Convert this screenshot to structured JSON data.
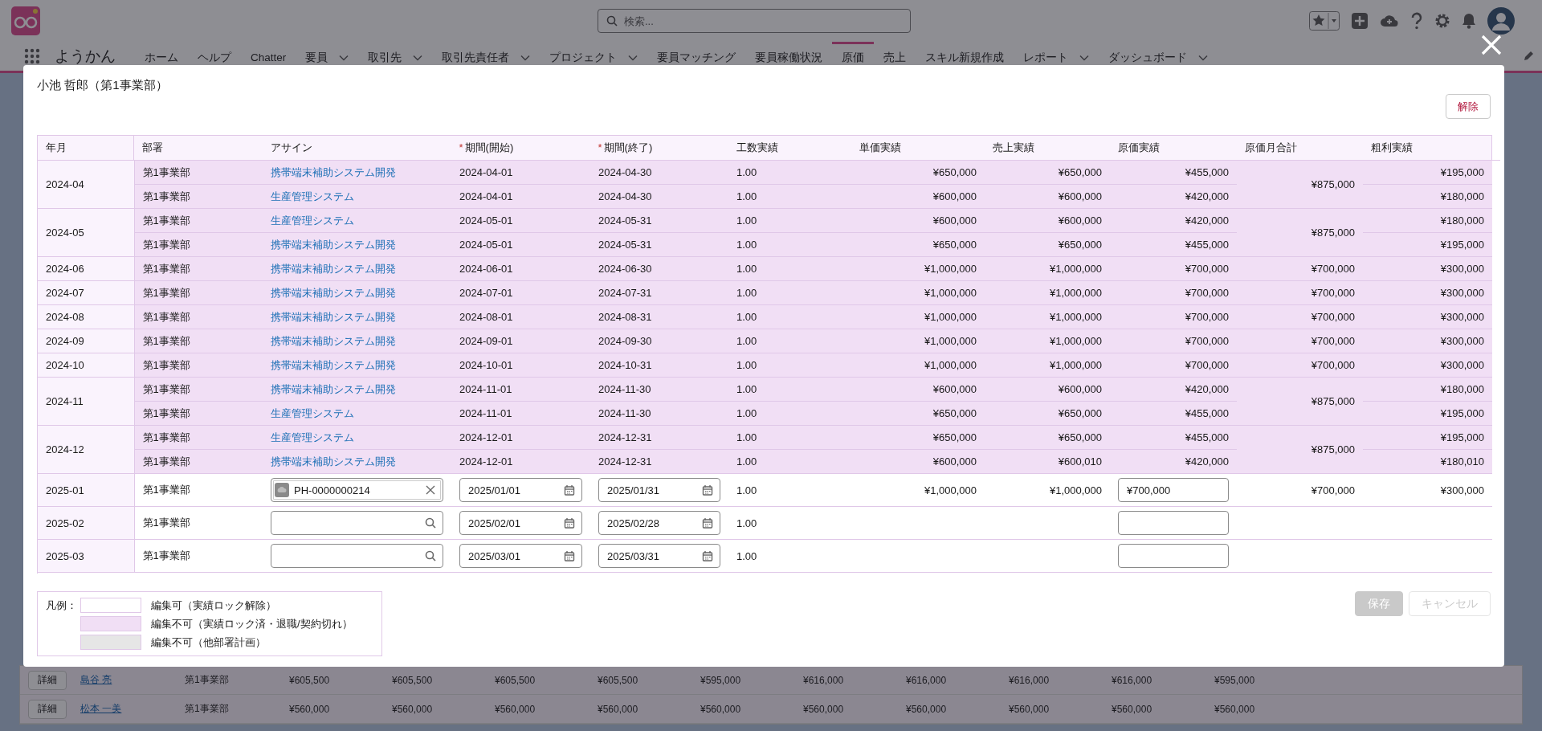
{
  "app": {
    "name": "ようかん",
    "search": {
      "placeholder": "検索..."
    },
    "nav": [
      {
        "label": "ホーム",
        "dropdown": false,
        "selected": false
      },
      {
        "label": "ヘルプ",
        "dropdown": false,
        "selected": false
      },
      {
        "label": "Chatter",
        "dropdown": false,
        "selected": false
      },
      {
        "label": "要員",
        "dropdown": true,
        "selected": false
      },
      {
        "label": "取引先",
        "dropdown": true,
        "selected": false
      },
      {
        "label": "取引先責任者",
        "dropdown": true,
        "selected": false
      },
      {
        "label": "プロジェクト",
        "dropdown": true,
        "selected": false
      },
      {
        "label": "要員マッチング",
        "dropdown": false,
        "selected": false
      },
      {
        "label": "要員稼働状況",
        "dropdown": false,
        "selected": false
      },
      {
        "label": "原価",
        "dropdown": false,
        "selected": true
      },
      {
        "label": "売上",
        "dropdown": false,
        "selected": false
      },
      {
        "label": "スキル新規作成",
        "dropdown": false,
        "selected": false
      },
      {
        "label": "レポート",
        "dropdown": true,
        "selected": false
      },
      {
        "label": "ダッシュボード",
        "dropdown": true,
        "selected": false
      }
    ]
  },
  "background_rows": [
    {
      "button": "詳細",
      "name": "島谷 亮",
      "dept": "第1事業部",
      "amounts": [
        "¥605,500",
        "¥605,500",
        "¥605,500",
        "¥605,500",
        "¥595,000",
        "¥616,000",
        "¥616,000",
        "¥616,000",
        "¥616,000",
        "¥595,000"
      ]
    },
    {
      "button": "詳細",
      "name": "松本 一美",
      "dept": "第1事業部",
      "amounts": [
        "¥560,000",
        "¥560,000",
        "¥560,000",
        "¥560,000",
        "¥560,000",
        "¥560,000",
        "¥560,000",
        "¥560,000",
        "¥560,000",
        "¥560,000"
      ]
    }
  ],
  "modal": {
    "title": "小池 哲郎（第1事業部）",
    "unlock_button": "解除",
    "table": {
      "columns": [
        {
          "label": "年月"
        },
        {
          "label": "部署"
        },
        {
          "label": "アサイン"
        },
        {
          "label": "期間(開始)",
          "marker": "*"
        },
        {
          "label": "期間(終了)",
          "marker": "*"
        },
        {
          "label": "工数実績"
        },
        {
          "label": "単価実績"
        },
        {
          "label": "売上実績"
        },
        {
          "label": "原価実績"
        },
        {
          "label": "原価月合計"
        },
        {
          "label": "粗利実績"
        }
      ],
      "months": [
        {
          "month": "2024-04",
          "locked": true,
          "cost_total": "¥875,000",
          "rows": [
            {
              "dept": "第1事業部",
              "assign": "携帯端末補助システム開発",
              "start": "2024-04-01",
              "end": "2024-04-30",
              "hours": "1.00",
              "unit_price": "¥650,000",
              "sales": "¥650,000",
              "cost": "¥455,000",
              "profit": "¥195,000"
            },
            {
              "dept": "第1事業部",
              "assign": "生産管理システム",
              "start": "2024-04-01",
              "end": "2024-04-30",
              "hours": "1.00",
              "unit_price": "¥600,000",
              "sales": "¥600,000",
              "cost": "¥420,000",
              "profit": "¥180,000"
            }
          ]
        },
        {
          "month": "2024-05",
          "locked": true,
          "cost_total": "¥875,000",
          "rows": [
            {
              "dept": "第1事業部",
              "assign": "生産管理システム",
              "start": "2024-05-01",
              "end": "2024-05-31",
              "hours": "1.00",
              "unit_price": "¥600,000",
              "sales": "¥600,000",
              "cost": "¥420,000",
              "profit": "¥180,000"
            },
            {
              "dept": "第1事業部",
              "assign": "携帯端末補助システム開発",
              "start": "2024-05-01",
              "end": "2024-05-31",
              "hours": "1.00",
              "unit_price": "¥650,000",
              "sales": "¥650,000",
              "cost": "¥455,000",
              "profit": "¥195,000"
            }
          ]
        },
        {
          "month": "2024-06",
          "locked": true,
          "cost_total": "¥700,000",
          "rows": [
            {
              "dept": "第1事業部",
              "assign": "携帯端末補助システム開発",
              "start": "2024-06-01",
              "end": "2024-06-30",
              "hours": "1.00",
              "unit_price": "¥1,000,000",
              "sales": "¥1,000,000",
              "cost": "¥700,000",
              "profit": "¥300,000"
            }
          ]
        },
        {
          "month": "2024-07",
          "locked": true,
          "cost_total": "¥700,000",
          "rows": [
            {
              "dept": "第1事業部",
              "assign": "携帯端末補助システム開発",
              "start": "2024-07-01",
              "end": "2024-07-31",
              "hours": "1.00",
              "unit_price": "¥1,000,000",
              "sales": "¥1,000,000",
              "cost": "¥700,000",
              "profit": "¥300,000"
            }
          ]
        },
        {
          "month": "2024-08",
          "locked": true,
          "cost_total": "¥700,000",
          "rows": [
            {
              "dept": "第1事業部",
              "assign": "携帯端末補助システム開発",
              "start": "2024-08-01",
              "end": "2024-08-31",
              "hours": "1.00",
              "unit_price": "¥1,000,000",
              "sales": "¥1,000,000",
              "cost": "¥700,000",
              "profit": "¥300,000"
            }
          ]
        },
        {
          "month": "2024-09",
          "locked": true,
          "cost_total": "¥700,000",
          "rows": [
            {
              "dept": "第1事業部",
              "assign": "携帯端末補助システム開発",
              "start": "2024-09-01",
              "end": "2024-09-30",
              "hours": "1.00",
              "unit_price": "¥1,000,000",
              "sales": "¥1,000,000",
              "cost": "¥700,000",
              "profit": "¥300,000"
            }
          ]
        },
        {
          "month": "2024-10",
          "locked": true,
          "cost_total": "¥700,000",
          "rows": [
            {
              "dept": "第1事業部",
              "assign": "携帯端末補助システム開発",
              "start": "2024-10-01",
              "end": "2024-10-31",
              "hours": "1.00",
              "unit_price": "¥1,000,000",
              "sales": "¥1,000,000",
              "cost": "¥700,000",
              "profit": "¥300,000"
            }
          ]
        },
        {
          "month": "2024-11",
          "locked": true,
          "cost_total": "¥875,000",
          "rows": [
            {
              "dept": "第1事業部",
              "assign": "携帯端末補助システム開発",
              "start": "2024-11-01",
              "end": "2024-11-30",
              "hours": "1.00",
              "unit_price": "¥600,000",
              "sales": "¥600,000",
              "cost": "¥420,000",
              "profit": "¥180,000"
            },
            {
              "dept": "第1事業部",
              "assign": "生産管理システム",
              "start": "2024-11-01",
              "end": "2024-11-30",
              "hours": "1.00",
              "unit_price": "¥650,000",
              "sales": "¥650,000",
              "cost": "¥455,000",
              "profit": "¥195,000"
            }
          ]
        },
        {
          "month": "2024-12",
          "locked": true,
          "cost_total": "¥875,000",
          "rows": [
            {
              "dept": "第1事業部",
              "assign": "生産管理システム",
              "start": "2024-12-01",
              "end": "2024-12-31",
              "hours": "1.00",
              "unit_price": "¥650,000",
              "sales": "¥650,000",
              "cost": "¥455,000",
              "profit": "¥195,000"
            },
            {
              "dept": "第1事業部",
              "assign": "携帯端末補助システム開発",
              "start": "2024-12-01",
              "end": "2024-12-31",
              "hours": "1.00",
              "unit_price": "¥600,000",
              "sales": "¥600,010",
              "cost": "¥420,000",
              "profit": "¥180,010"
            }
          ]
        },
        {
          "month": "2025-01",
          "locked": false,
          "cost_total": "¥700,000",
          "rows": [
            {
              "dept": "第1事業部",
              "assign": "PH-0000000214",
              "start": "2025/01/01",
              "end": "2025/01/31",
              "hours": "1.00",
              "unit_price": "¥1,000,000",
              "sales": "¥1,000,000",
              "cost": "¥700,000",
              "profit": "¥300,000"
            }
          ]
        },
        {
          "month": "2025-02",
          "locked": false,
          "rows": [
            {
              "dept": "第1事業部",
              "start": "2025/02/01",
              "end": "2025/02/28",
              "hours": "1.00"
            }
          ]
        },
        {
          "month": "2025-03",
          "locked": false,
          "rows": [
            {
              "dept": "第1事業部",
              "start": "2025/03/01",
              "end": "2025/03/31",
              "hours": "1.00"
            }
          ]
        }
      ]
    },
    "legend": {
      "label": "凡例：",
      "items": [
        {
          "text": "編集可（実績ロック解除）",
          "color": "#ffffff"
        },
        {
          "text": "編集不可（実績ロック済・退職/契約切れ）",
          "color": "#f1dff5"
        },
        {
          "text": "編集不可（他部署計画）",
          "color": "#e6e6e6"
        }
      ]
    },
    "buttons": [
      {
        "label": "保存",
        "kind": "primary",
        "disabled": true
      },
      {
        "label": "キャンセル",
        "kind": "secondary",
        "disabled": true
      }
    ]
  }
}
